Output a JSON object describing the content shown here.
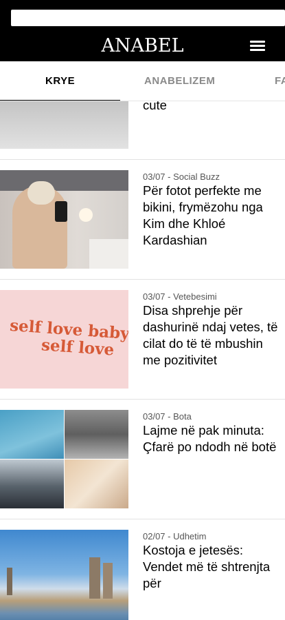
{
  "header": {
    "logo": "ANABEL",
    "menu_icon": "hamburger-menu-icon"
  },
  "tabs": [
    {
      "label": "KRYE",
      "active": true
    },
    {
      "label": "ANABELIZEM",
      "active": false
    },
    {
      "label": "FA",
      "active": false
    }
  ],
  "articles": [
    {
      "title": "cute",
      "meta": ""
    },
    {
      "meta": "03/07 - Social Buzz",
      "title": "Për fotot perfekte me bikini, frymëzohu nga Kim dhe Khloé Kardashian"
    },
    {
      "meta": "03/07 - Vetebesimi",
      "title": "Disa shprehje për dashurinë ndaj vetes, të cilat do të të mbushin me pozitivitet",
      "image_text": [
        "self love baby",
        "self love"
      ]
    },
    {
      "meta": "03/07 - Bota",
      "title": "Lajme në pak minuta: Çfarë po ndodh në botë"
    },
    {
      "meta": "02/07 - Udhetim",
      "title": "Kostoja e jetesës: Vendet më të shtrenjta për"
    }
  ],
  "colors": {
    "header_bg": "#000000",
    "tab_active": "#000000",
    "tab_inactive": "#8a8a8a",
    "self_love_text": "#d65a37",
    "self_love_bg": "#f6d6d6"
  }
}
